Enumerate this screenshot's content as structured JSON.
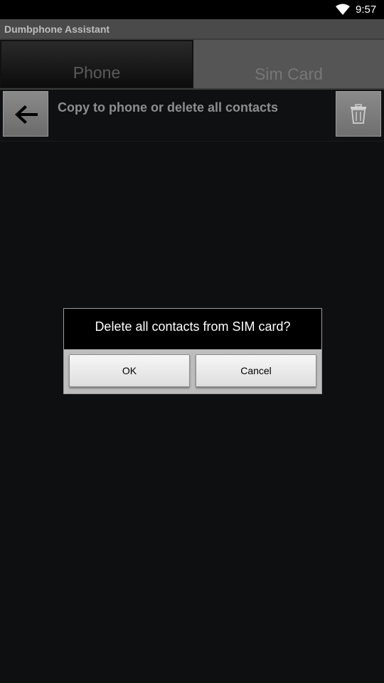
{
  "status_bar": {
    "time": "9:57",
    "wifi_icon": "wifi-icon"
  },
  "app": {
    "title": "Dumbphone Assistant"
  },
  "tabs": [
    {
      "label": "Phone",
      "selected": false
    },
    {
      "label": "Sim Card",
      "selected": true
    }
  ],
  "toolbar": {
    "back_icon": "arrow-left-icon",
    "label": "Copy to phone or delete all contacts",
    "delete_icon": "trash-icon"
  },
  "dialog": {
    "message": "Delete all contacts from SIM card?",
    "ok_label": "OK",
    "cancel_label": "Cancel"
  },
  "colors": {
    "background": "#0e0f11",
    "title_bar": "#4a4a4a",
    "dialog_button_strip": "#bdbdbd"
  }
}
